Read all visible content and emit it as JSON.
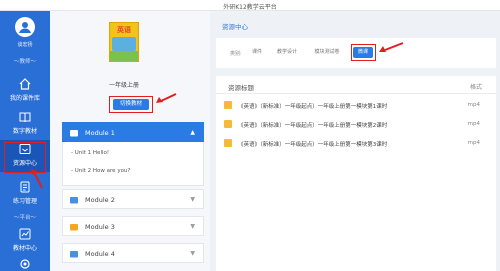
{
  "window": {
    "title": "外研K12教学云平台"
  },
  "sidebar": {
    "user_name": "谈宏扬",
    "section_teacher": "～教师～",
    "section_platform": "～平台～",
    "items": [
      {
        "label": "我的课件库",
        "icon": "home-icon"
      },
      {
        "label": "数字教材",
        "icon": "book-icon"
      },
      {
        "label": "资源中心",
        "icon": "resource-icon"
      },
      {
        "label": "练习管理",
        "icon": "exercise-icon"
      },
      {
        "label": "教材中心",
        "icon": "chart-icon"
      }
    ]
  },
  "textbook": {
    "cover_title": "英语",
    "grade": "一年级上册",
    "switch_label": "切换教材"
  },
  "modules": [
    {
      "label": "Module 1",
      "expanded": true,
      "units": [
        "Unit 1 Hello!",
        "Unit 2 How are you?"
      ]
    },
    {
      "label": "Module 2",
      "expanded": false
    },
    {
      "label": "Module 3",
      "expanded": false
    },
    {
      "label": "Module 4",
      "expanded": false
    }
  ],
  "main": {
    "title": "资源中心",
    "filter_label": "类别:",
    "chips": [
      "课件",
      "教学设计",
      "模块测试卷",
      "微课"
    ],
    "selected_chip": "微课",
    "list_header": "资源标题",
    "format_header": "格式",
    "resources": [
      {
        "title": "《英语》（新标准）一年级起点）一年级上册第一模块第1课时",
        "format": "mp4"
      },
      {
        "title": "《英语》（新标准）一年级起点）一年级上册第一模块第2课时",
        "format": "mp4"
      },
      {
        "title": "《英语》（新标准）一年级起点）一年级上册第一模块第3课时",
        "format": "mp4"
      }
    ]
  },
  "colors": {
    "accent": "#2a7be4",
    "sidebar": "#2a6fd6",
    "highlight": "#e02020"
  }
}
